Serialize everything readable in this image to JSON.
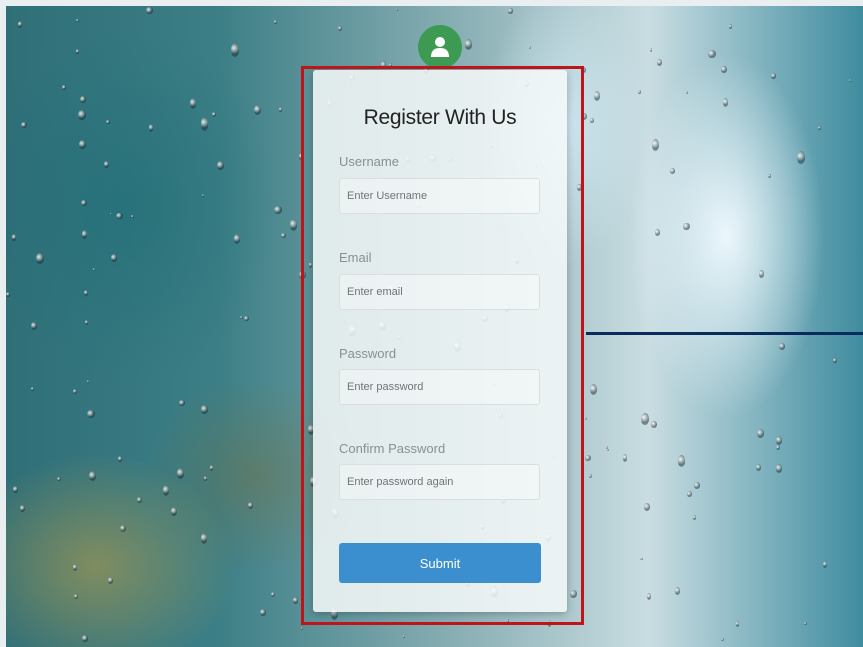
{
  "form": {
    "title": "Register With Us",
    "avatar_icon": "user-icon",
    "fields": [
      {
        "label": "Username",
        "placeholder": "Enter Username"
      },
      {
        "label": "Email",
        "placeholder": "Enter email"
      },
      {
        "label": "Password",
        "placeholder": "Enter password"
      },
      {
        "label": "Confirm Password",
        "placeholder": "Enter password again"
      }
    ],
    "submit_label": "Submit"
  },
  "colors": {
    "accent": "#3c8fcf",
    "avatar": "#3c9a52",
    "highlight_border": "#c0141b",
    "line": "#0b2b5c"
  }
}
